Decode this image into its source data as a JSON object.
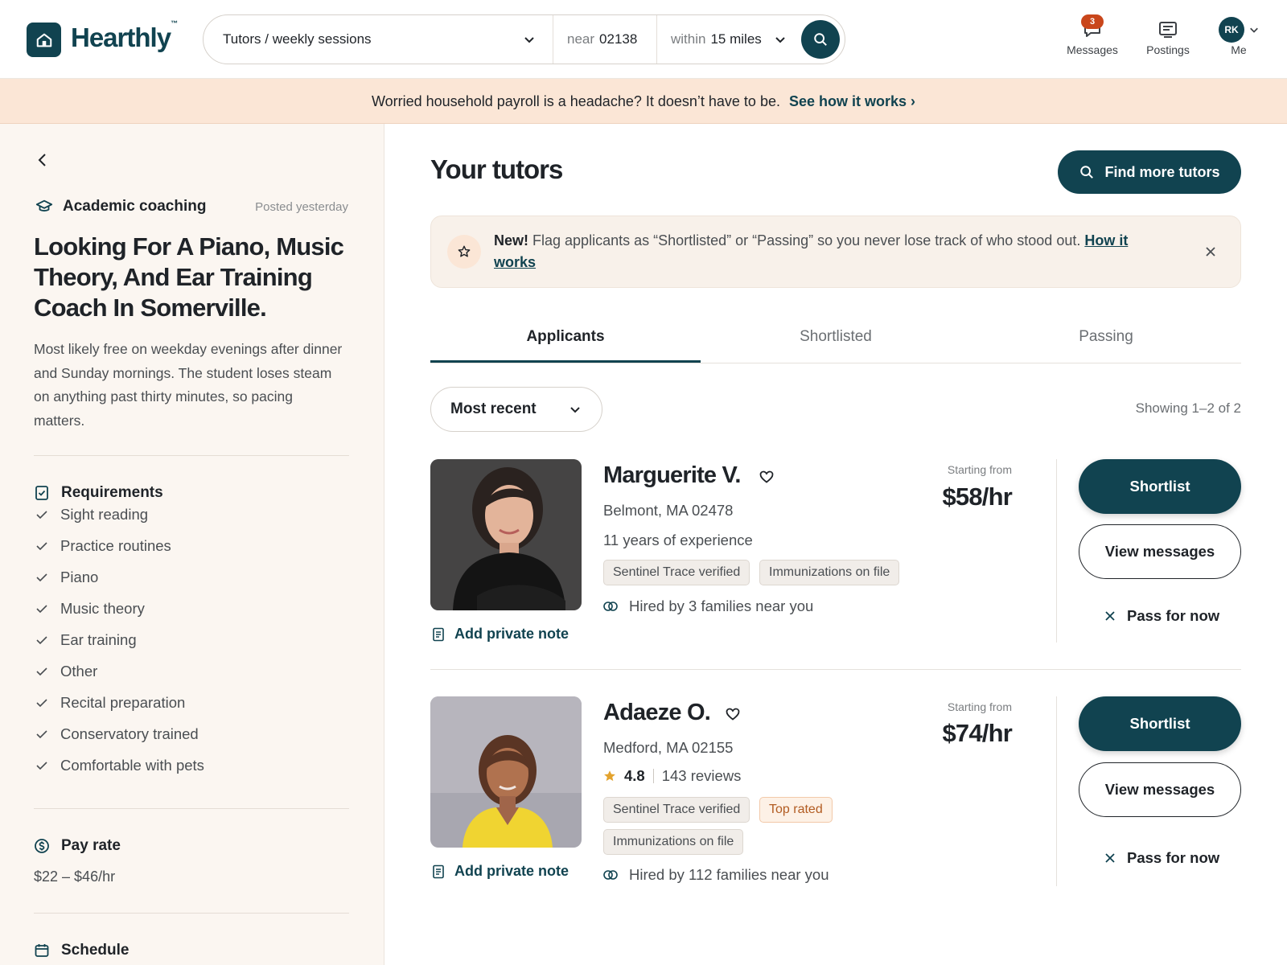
{
  "brand": {
    "name": "Hearthly",
    "tm": "™",
    "color": "#114350"
  },
  "search": {
    "service": "Tutors / weekly sessions",
    "near_label": "near",
    "near_value": "02138",
    "within_label": "within",
    "within_value": "15 miles"
  },
  "nav": {
    "messages": {
      "label": "Messages",
      "badge": "3"
    },
    "postings": {
      "label": "Postings"
    },
    "me": {
      "label": "Me",
      "initials": "RK"
    }
  },
  "banner": {
    "text": "Worried household payroll is a headache? It doesn’t have to be.",
    "link": "See how it works ›"
  },
  "job": {
    "category": "Academic coaching",
    "posted": "Posted yesterday",
    "title": "Looking For A Piano, Music Theory, And Ear Training Coach In Somerville.",
    "description": "Most likely free on weekday evenings after dinner and Sunday mornings. The student loses steam on anything past thirty minutes, so pacing matters.",
    "requirements_heading": "Requirements",
    "requirements": [
      "Sight reading",
      "Practice routines",
      "Piano",
      "Music theory",
      "Ear training",
      "Other",
      "Recital preparation",
      "Conservatory trained",
      "Comfortable with pets"
    ],
    "pay_heading": "Pay rate",
    "pay_value": "$22 – $46/hr",
    "schedule_heading": "Schedule"
  },
  "main": {
    "title": "Your tutors",
    "find_button": "Find more tutors",
    "notice": {
      "bold": "New!",
      "text": " Flag applicants as “Shortlisted” or “Passing” so you never lose track of who stood out. ",
      "link": "How it works"
    },
    "tabs": [
      "Applicants",
      "Shortlisted",
      "Passing"
    ],
    "active_tab": "Applicants",
    "sort": "Most recent",
    "showing": "Showing 1–2 of 2"
  },
  "applicants": [
    {
      "name": "Marguerite V.",
      "location": "Belmont, MA 02478",
      "experience": "11 years of experience",
      "chips": [
        "Sentinel Trace verified",
        "Immunizations on file"
      ],
      "hired": "Hired by 3 families near you",
      "price_label": "Starting from",
      "price": "$58/hr",
      "note": "Add private note",
      "shortlist": "Shortlist",
      "view": "View messages",
      "pass": "Pass for now"
    },
    {
      "name": "Adaeze O.",
      "location": "Medford, MA 02155",
      "rating": "4.8",
      "reviews": "143 reviews",
      "chips": [
        "Sentinel Trace verified",
        "Top rated",
        "Immunizations on file"
      ],
      "hired": "Hired by 112 families near you",
      "price_label": "Starting from",
      "price": "$74/hr",
      "note": "Add private note",
      "shortlist": "Shortlist",
      "view": "View messages",
      "pass": "Pass for now"
    }
  ]
}
